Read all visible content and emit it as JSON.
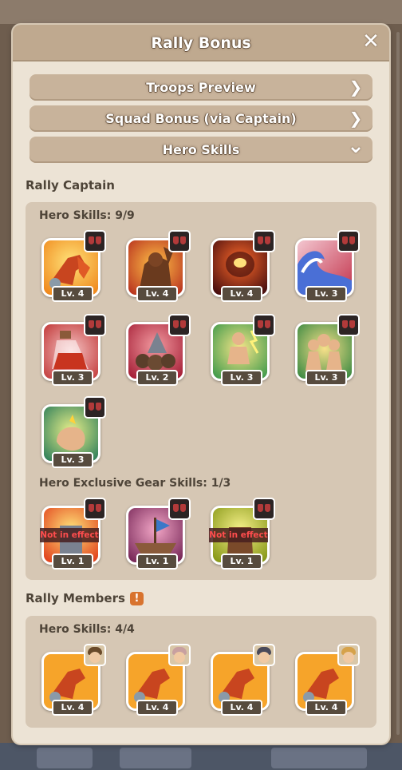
{
  "modal": {
    "title": "Rally Bonus",
    "close_icon": "close-icon"
  },
  "accordions": [
    {
      "label": "Troops Preview",
      "icon": "chevron-right-icon",
      "glyph": "❯"
    },
    {
      "label": "Squad Bonus (via Captain)",
      "icon": "chevron-right-icon",
      "glyph": "❯"
    },
    {
      "label": "Hero Skills",
      "icon": "chevron-down-icon",
      "glyph": "⌄"
    }
  ],
  "rally_captain": {
    "title": "Rally Captain",
    "hero_skills_title": "Hero Skills: 9/9",
    "skills": [
      {
        "level": "Lv. 4",
        "icon": "rocket-fist-skill-icon"
      },
      {
        "level": "Lv. 4",
        "icon": "shadow-warrior-skill-icon"
      },
      {
        "level": "Lv. 4",
        "icon": "fire-demon-skill-icon"
      },
      {
        "level": "Lv. 3",
        "icon": "tidal-wave-skill-icon"
      },
      {
        "level": "Lv. 3",
        "icon": "potion-bottle-skill-icon"
      },
      {
        "level": "Lv. 2",
        "icon": "boulder-pile-skill-icon"
      },
      {
        "level": "Lv. 3",
        "icon": "lightning-soldier-skill-icon"
      },
      {
        "level": "Lv. 3",
        "icon": "troop-squad-skill-icon"
      },
      {
        "level": "Lv. 3",
        "icon": "power-fist-skill-icon"
      }
    ],
    "gear_title": "Hero Exclusive Gear Skills: 1/3",
    "gear_skills": [
      {
        "level": "Lv. 1",
        "icon": "iron-gauntlet-skill-icon",
        "status": "Not in effect"
      },
      {
        "level": "Lv. 1",
        "icon": "pirate-ship-skill-icon",
        "status": ""
      },
      {
        "level": "Lv. 1",
        "icon": "golden-hand-skill-icon",
        "status": "Not in effect"
      }
    ]
  },
  "rally_members": {
    "title": "Rally Members",
    "warning_glyph": "!",
    "hero_skills_title": "Hero Skills: 4/4",
    "skills": [
      {
        "level": "Lv. 4",
        "icon": "rocket-fist-skill-icon",
        "avatar": "member-avatar-1"
      },
      {
        "level": "Lv. 4",
        "icon": "rocket-fist-skill-icon",
        "avatar": "member-avatar-2"
      },
      {
        "level": "Lv. 4",
        "icon": "rocket-fist-skill-icon",
        "avatar": "member-avatar-3"
      },
      {
        "level": "Lv. 4",
        "icon": "rocket-fist-skill-icon",
        "avatar": "member-avatar-4"
      }
    ]
  }
}
